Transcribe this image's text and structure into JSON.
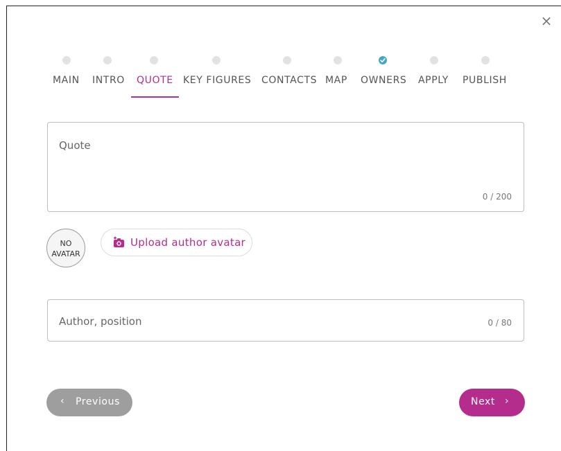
{
  "dialog": {
    "close_glyph": "×"
  },
  "steps": [
    {
      "label": "MAIN",
      "state": "todo"
    },
    {
      "label": "INTRO",
      "state": "todo"
    },
    {
      "label": "QUOTE",
      "state": "active"
    },
    {
      "label": "KEY FIGURES",
      "state": "todo"
    },
    {
      "label": "CONTACTS",
      "state": "todo"
    },
    {
      "label": "MAP",
      "state": "todo"
    },
    {
      "label": "OWNERS",
      "state": "done"
    },
    {
      "label": "APPLY",
      "state": "todo"
    },
    {
      "label": "PUBLISH",
      "state": "todo"
    }
  ],
  "quote_field": {
    "label": "Quote",
    "counter": "0 / 200"
  },
  "avatar": {
    "line1": "NO",
    "line2": "AVATAR"
  },
  "upload_button": {
    "label": "Upload author avatar",
    "icon": "camera-plus-icon"
  },
  "author_field": {
    "label": "Author, position",
    "counter": "0 / 80"
  },
  "nav": {
    "previous_label": "Previous",
    "previous_chevron": "‹",
    "next_label": "Next",
    "next_chevron": "›"
  },
  "colors": {
    "accent": "#b42d8c",
    "done_step": "#45a7c5",
    "step_dot": "#e2e2e2",
    "previous_button": "#9e9e9e"
  }
}
